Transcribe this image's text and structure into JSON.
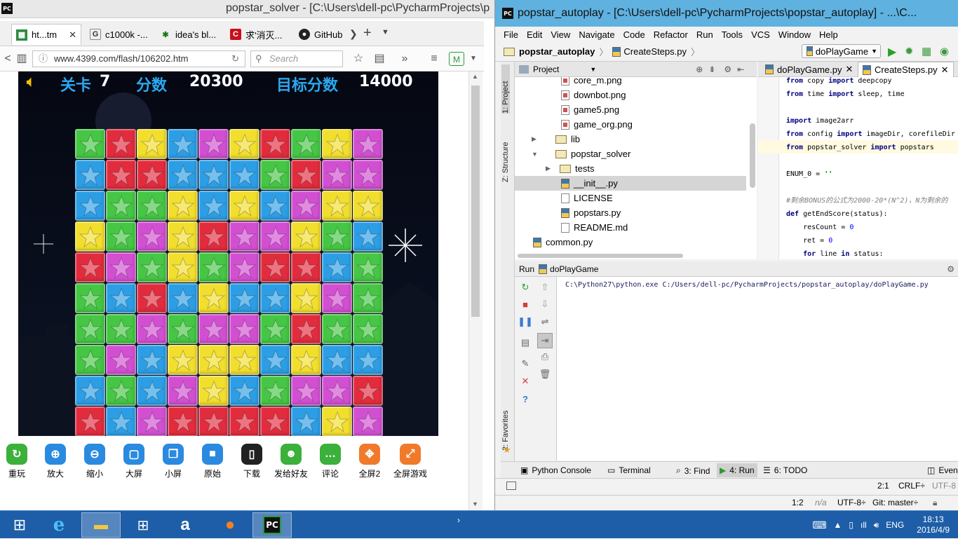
{
  "back_window": {
    "title": "popstar_solver - [C:\\Users\\dell-pc\\PycharmProjects\\p"
  },
  "firefox": {
    "tabs": [
      {
        "label": "ht...tm",
        "icon": "grid-page-icon",
        "close": "✕"
      },
      {
        "label": "c1000k -...",
        "icon": "g-logo-icon"
      },
      {
        "label": "idea's bl...",
        "icon": "bug-icon"
      },
      {
        "label": "求'消灭...",
        "icon": "c-logo-icon"
      },
      {
        "label": "GitHub",
        "icon": "github-icon"
      }
    ],
    "url": "www.4399.com/flash/106202.htm",
    "search_placeholder": "Search"
  },
  "game": {
    "level_label": "关卡",
    "level": "7",
    "score_label": "分数",
    "score": "20300",
    "target_label": "目标分数",
    "target": "14000",
    "board": [
      [
        "g",
        "r",
        "y",
        "b",
        "p",
        "y",
        "r",
        "g",
        "y",
        "p"
      ],
      [
        "b",
        "r",
        "r",
        "b",
        "b",
        "b",
        "g",
        "r",
        "p",
        "p"
      ],
      [
        "b",
        "g",
        "g",
        "y",
        "b",
        "y",
        "b",
        "p",
        "y",
        "y"
      ],
      [
        "y",
        "g",
        "p",
        "y",
        "r",
        "p",
        "p",
        "y",
        "g",
        "b"
      ],
      [
        "r",
        "p",
        "g",
        "y",
        "g",
        "p",
        "r",
        "r",
        "b",
        "g"
      ],
      [
        "g",
        "b",
        "r",
        "b",
        "y",
        "b",
        "b",
        "y",
        "p",
        "g"
      ],
      [
        "g",
        "g",
        "p",
        "g",
        "p",
        "p",
        "g",
        "r",
        "g",
        "g"
      ],
      [
        "g",
        "p",
        "b",
        "y",
        "y",
        "y",
        "b",
        "y",
        "b",
        "b"
      ],
      [
        "b",
        "g",
        "b",
        "p",
        "y",
        "b",
        "g",
        "p",
        "p",
        "r"
      ],
      [
        "r",
        "b",
        "p",
        "r",
        "r",
        "r",
        "r",
        "b",
        "y",
        "p"
      ]
    ],
    "colors": {
      "g": "#45c644",
      "r": "#e22c3e",
      "y": "#f2de2c",
      "b": "#2c9ee5",
      "p": "#d24fd2"
    }
  },
  "game_tools": [
    {
      "label": "重玩",
      "icon": "refresh-icon",
      "color": "#3bb03b"
    },
    {
      "label": "放大",
      "icon": "zoom-in-icon",
      "color": "#2a8ae0"
    },
    {
      "label": "缩小",
      "icon": "zoom-out-icon",
      "color": "#2a8ae0"
    },
    {
      "label": "大屏",
      "icon": "large-screen-icon",
      "color": "#2a8ae0"
    },
    {
      "label": "小屏",
      "icon": "small-screen-icon",
      "color": "#2a8ae0"
    },
    {
      "label": "原始",
      "icon": "original-size-icon",
      "color": "#2a8ae0"
    },
    {
      "label": "下载",
      "icon": "phone-download-icon",
      "color": "#222"
    },
    {
      "label": "发给好友",
      "icon": "share-friend-icon",
      "color": "#3bb03b"
    },
    {
      "label": "评论",
      "icon": "comment-icon",
      "color": "#3bb03b"
    },
    {
      "label": "全屏2",
      "icon": "fullscreen2-icon",
      "color": "#f07a2a"
    },
    {
      "label": "全屏游戏",
      "icon": "fullscreen-game-icon",
      "color": "#f07a2a"
    }
  ],
  "pycharm": {
    "title": "popstar_autoplay - [C:\\Users\\dell-pc\\PycharmProjects\\popstar_autoplay] - ...\\C...",
    "menu": [
      "File",
      "Edit",
      "View",
      "Navigate",
      "Code",
      "Refactor",
      "Run",
      "Tools",
      "VCS",
      "Window",
      "Help"
    ],
    "breadcrumb_project": "popstar_autoplay",
    "breadcrumb_file": "CreateSteps.py",
    "run_config": "doPlayGame",
    "project_label": "Project",
    "sidebar_tabs": {
      "project": "1: Project",
      "structure": "Z: Structure",
      "favorites": "2: Favorites"
    },
    "tree": [
      {
        "name": "core_m.png",
        "type": "img",
        "indent": 2
      },
      {
        "name": "downbot.png",
        "type": "img",
        "indent": 2
      },
      {
        "name": "game5.png",
        "type": "img",
        "indent": 2
      },
      {
        "name": "game_org.png",
        "type": "img",
        "indent": 2
      },
      {
        "name": "lib",
        "type": "dir",
        "indent": 1,
        "arrow": "▶"
      },
      {
        "name": "popstar_solver",
        "type": "dir",
        "indent": 1,
        "arrow": "▼"
      },
      {
        "name": "tests",
        "type": "dir",
        "indent": 2,
        "arrow": "▶"
      },
      {
        "name": "__init__.py",
        "type": "py",
        "indent": 2,
        "selected": true
      },
      {
        "name": "LICENSE",
        "type": "file",
        "indent": 2
      },
      {
        "name": "popstars.py",
        "type": "py",
        "indent": 2
      },
      {
        "name": "README.md",
        "type": "file",
        "indent": 2
      },
      {
        "name": "common.py",
        "type": "py",
        "indent": 1
      }
    ],
    "editor_tabs": [
      {
        "label": "doPlayGame.py"
      },
      {
        "label": "CreateSteps.py",
        "active": true
      }
    ],
    "code": [
      [
        {
          "t": "from ",
          "c": "kw"
        },
        {
          "t": "copy "
        },
        {
          "t": "import ",
          "c": "kw"
        },
        {
          "t": "deepcopy"
        }
      ],
      [
        {
          "t": "from ",
          "c": "kw"
        },
        {
          "t": "time "
        },
        {
          "t": "import ",
          "c": "kw"
        },
        {
          "t": "sleep, time"
        }
      ],
      [
        {
          "t": ""
        }
      ],
      [
        {
          "t": "import ",
          "c": "kw"
        },
        {
          "t": "image2arr"
        }
      ],
      [
        {
          "t": "from ",
          "c": "kw"
        },
        {
          "t": "config "
        },
        {
          "t": "import ",
          "c": "kw"
        },
        {
          "t": "imageDir, corefileDir"
        }
      ],
      [
        {
          "t": "from ",
          "c": "kw"
        },
        {
          "t": "popstar_solver "
        },
        {
          "t": "import ",
          "c": "kw"
        },
        {
          "t": "popstars"
        }
      ],
      [
        {
          "t": ""
        }
      ],
      [
        {
          "t": "ENUM_0 = "
        },
        {
          "t": "''",
          "c": "str"
        }
      ],
      [
        {
          "t": ""
        }
      ],
      [
        {
          "t": "#剩余BONUS的公式为2000-20*(N^2)，N为剩余的",
          "c": "cm"
        }
      ],
      [
        {
          "t": "def ",
          "c": "kw"
        },
        {
          "t": "getEndScore(status):"
        }
      ],
      [
        {
          "t": "    resCount = "
        },
        {
          "t": "0",
          "c": "num"
        }
      ],
      [
        {
          "t": "    ret = "
        },
        {
          "t": "0",
          "c": "num"
        }
      ],
      [
        {
          "t": "    "
        },
        {
          "t": "for ",
          "c": "kw"
        },
        {
          "t": "line "
        },
        {
          "t": "in ",
          "c": "kw"
        },
        {
          "t": "status:"
        }
      ]
    ],
    "run_label": "Run",
    "run_name": "doPlayGame",
    "console": "C:\\Python27\\python.exe C:/Users/dell-pc/PycharmProjects/popstar_autoplay/doPlayGame.py",
    "bottom_tabs": [
      {
        "label": "Python Console",
        "icon": "python-console-icon"
      },
      {
        "label": "Terminal",
        "icon": "terminal-icon"
      },
      {
        "label": "3: Find",
        "icon": "find-icon"
      },
      {
        "label": "4: Run",
        "icon": "run-icon",
        "active": true
      },
      {
        "label": "6: TODO",
        "icon": "todo-icon"
      },
      {
        "label": "Event",
        "icon": "event-log-icon"
      }
    ],
    "status1": {
      "pos": "2:1",
      "crlf": "CRLF÷",
      "enc": "UTF-8"
    },
    "status2": {
      "pos": "1:2",
      "na": "n/a",
      "enc": "UTF-8÷",
      "git": "Git: master÷"
    }
  },
  "taskbar": {
    "apps": [
      "start",
      "ie",
      "explorer",
      "store",
      "amazon",
      "firefox",
      "pycharm"
    ],
    "lang": "ENG",
    "time": "18:13",
    "date": "2016/4/9"
  }
}
